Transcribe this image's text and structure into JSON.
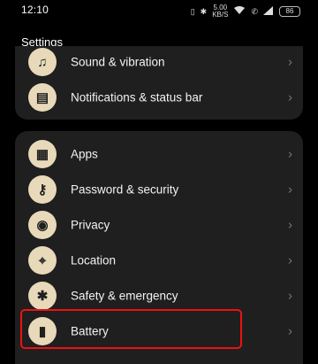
{
  "status_bar": {
    "time": "12:10",
    "network_speed_top": "5.00",
    "network_speed_bottom": "KB/S",
    "battery_level": "86"
  },
  "header": {
    "title": "Settings"
  },
  "settings_group_1": [
    {
      "label": "Sound & vibration",
      "icon": "sound-icon"
    },
    {
      "label": "Notifications & status bar",
      "icon": "notification-icon"
    }
  ],
  "settings_group_2": [
    {
      "label": "Apps",
      "icon": "apps-icon"
    },
    {
      "label": "Password & security",
      "icon": "key-icon"
    },
    {
      "label": "Privacy",
      "icon": "privacy-icon"
    },
    {
      "label": "Location",
      "icon": "location-icon"
    },
    {
      "label": "Safety & emergency",
      "icon": "asterisk-icon"
    },
    {
      "label": "Battery",
      "icon": "battery-icon"
    }
  ],
  "colors": {
    "background": "#000000",
    "card": "#1f1f1f",
    "icon_bg": "#e7d9b9",
    "highlight": "#ee1111"
  }
}
